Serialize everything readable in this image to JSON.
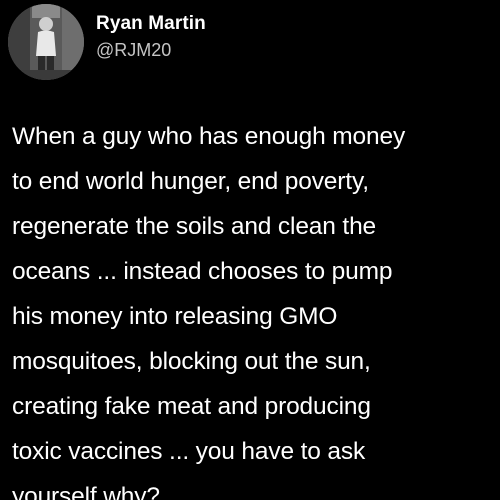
{
  "author": {
    "display_name": "Ryan Martin",
    "handle": "@RJM20",
    "avatar_icon": "profile-photo-man-standing"
  },
  "tweet": {
    "lines": [
      "When a guy who has enough money",
      "to end world hunger, end poverty,",
      "regenerate the soils and clean the",
      "oceans ... instead chooses to pump",
      "his money into releasing GMO",
      "mosquitoes, blocking out the sun,",
      "creating fake meat and producing",
      "toxic vaccines ... you have to ask",
      "yourself why?"
    ]
  },
  "colors": {
    "background": "#000000",
    "text": "#ffffff",
    "handle": "#c4c4c4"
  }
}
